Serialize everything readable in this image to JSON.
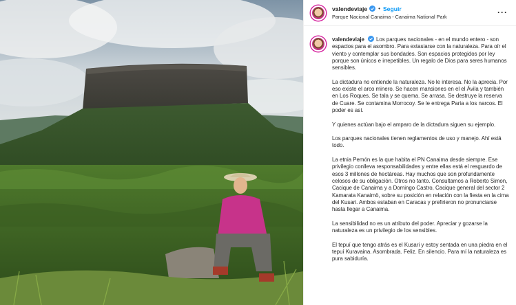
{
  "header": {
    "username": "valendeviaje",
    "separator": "•",
    "follow_label": "Seguir",
    "location": "Parque Nacional Canaima - Canaima National Park",
    "more_icon": "more-dots-icon"
  },
  "caption": {
    "username": "valendeviaje",
    "paragraphs": [
      "Los parques nacionales - en el mundo entero - son espacios para el asombro. Para extasiarse con la naturaleza. Para oír el viento y contemplar sus bondades. Son espacios protegidos por ley porque son únicos e irrepetibles. Un regalo de Dios para seres humanos sensibles.",
      "La dictadura no entiende la naturaleza. No le interesa. No la aprecia. Por eso existe el arco minero. Se hacen mansiones en el el Ávila y también en Los Roques. Se tala y se quema. Se arrasa. Se destruye la reserva de Cuare. Se contamina Morrocoy. Se le entrega Paria a los narcos. El poder es así.",
      "Y quienes actúan bajo el amparo de la dictadura siguen su ejemplo.",
      "Los parques nacionales tienen reglamentos de uso y manejo. Ahí está todo.",
      "La etnia Pemón es la que habita el PN Canaima desde siempre. Ese privilegio conlleva responsabilidades y entre ellas está el resguardo de esos 3 millones de hectáreas. Hay muchos que son profundamente celosos de su obligación. Otros no tanto. Consultamos a Roberto Simon, Cacique de Canaima y a Domingo Castro, Cacique general del sector 2 Kamarata Kanaimö, sobre su posición en relación con la fiesta en la cima del Kusari. Ambos estaban en Caracas y prefirieron no pronunciarse hasta llegar a Canaima.",
      "La sensibilidad no es un atributo del poder. Apreciar y gozarse la naturaleza es un privilegio de los sensibles.",
      "El tepuí que tengo atrás es el Kusari y estoy sentada en una piedra en el tepuí Kuravaina. Asombrada. Feliz. En silencio. Para mí la naturaleza es pura sabiduría."
    ]
  },
  "colors": {
    "accent": "#0095f6",
    "text": "#262626",
    "verified": "#3897f0"
  }
}
